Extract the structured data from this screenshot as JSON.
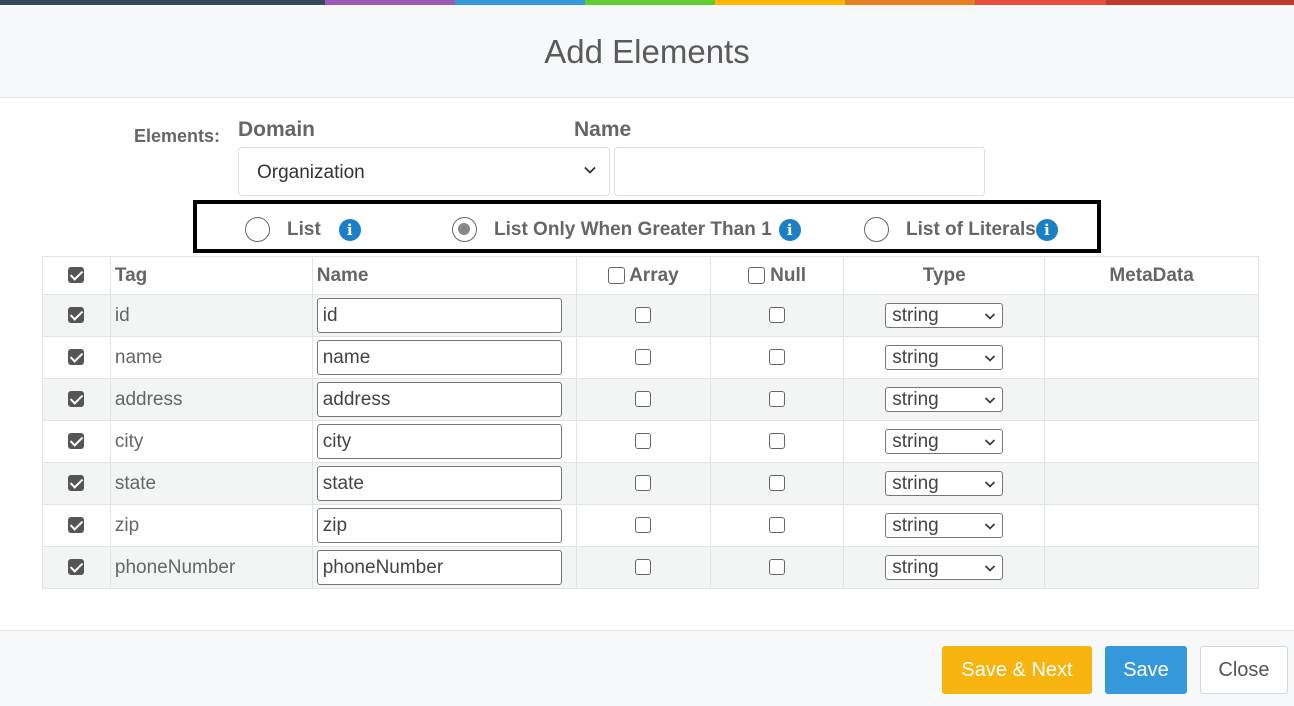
{
  "topbar_colors": [
    "#34495e",
    "#9b59b6",
    "#3498db",
    "#62cb31",
    "#ffb606",
    "#e67e22",
    "#e74c3c",
    "#c0392b"
  ],
  "dialog": {
    "title": "Add Elements"
  },
  "form": {
    "elements_label": "Elements:",
    "domain_label": "Domain",
    "name_label": "Name",
    "domain_value": "Organization",
    "name_value": ""
  },
  "radio_options": [
    {
      "label": "List",
      "checked": false
    },
    {
      "label": "List Only When Greater Than 1",
      "checked": true
    },
    {
      "label": "List of Literals",
      "checked": false
    }
  ],
  "table": {
    "headers": {
      "tag": "Tag",
      "name": "Name",
      "array": "Array",
      "null": "Null",
      "type": "Type",
      "metadata": "MetaData"
    },
    "rows": [
      {
        "checked": true,
        "tag": "id",
        "name": "id",
        "array": false,
        "null": false,
        "type": "string",
        "metadata": ""
      },
      {
        "checked": true,
        "tag": "name",
        "name": "name",
        "array": false,
        "null": false,
        "type": "string",
        "metadata": ""
      },
      {
        "checked": true,
        "tag": "address",
        "name": "address",
        "array": false,
        "null": false,
        "type": "string",
        "metadata": ""
      },
      {
        "checked": true,
        "tag": "city",
        "name": "city",
        "array": false,
        "null": false,
        "type": "string",
        "metadata": ""
      },
      {
        "checked": true,
        "tag": "state",
        "name": "state",
        "array": false,
        "null": false,
        "type": "string",
        "metadata": ""
      },
      {
        "checked": true,
        "tag": "zip",
        "name": "zip",
        "array": false,
        "null": false,
        "type": "string",
        "metadata": ""
      },
      {
        "checked": true,
        "tag": "phoneNumber",
        "name": "phoneNumber",
        "array": false,
        "null": false,
        "type": "string",
        "metadata": ""
      }
    ]
  },
  "footer": {
    "save_next": "Save & Next",
    "save": "Save",
    "close": "Close"
  }
}
